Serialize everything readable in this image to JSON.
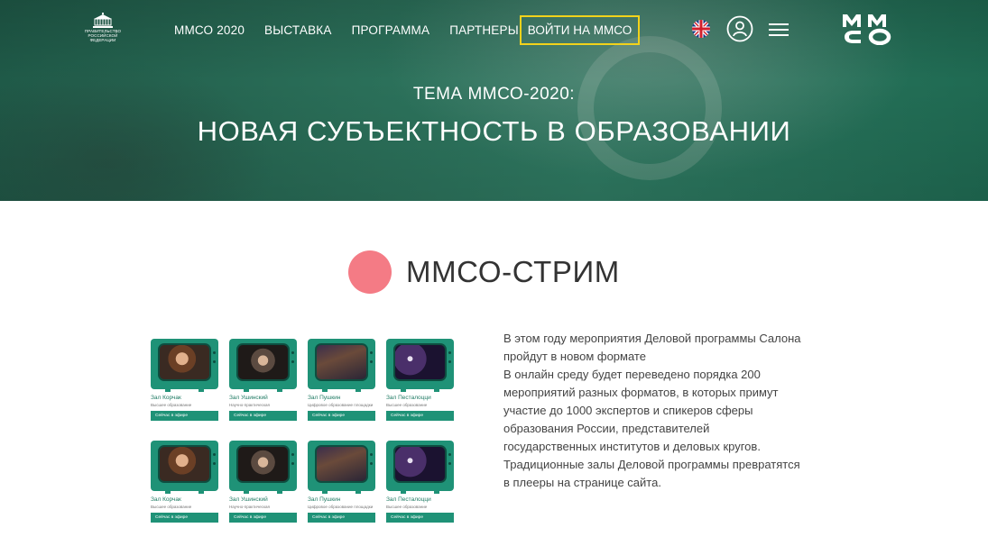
{
  "header": {
    "gov_logo_text": "ПРАВИТЕЛЬСТВО РОССИЙСКОЙ ФЕДЕРАЦИИ",
    "nav": [
      "ММСО 2020",
      "ВЫСТАВКА",
      "ПРОГРАММА",
      "ПАРТНЕРЫ"
    ],
    "login_label": "ВОЙТИ НА ММСО",
    "brand": "ММСО"
  },
  "hero": {
    "subtitle": "ТЕМА ММСО-2020:",
    "title": "НОВАЯ СУБЪЕКТНОСТЬ В ОБРАЗОВАНИИ"
  },
  "stream": {
    "title": "ММСО-СТРИМ",
    "cards": [
      {
        "name": "Зал Корчак",
        "desc": "Высшее образование",
        "button": "Сейчас в эфире"
      },
      {
        "name": "Зал Ушинский",
        "desc": "Научно-практическая",
        "button": "Сейчас в эфире"
      },
      {
        "name": "Зал Пушкин",
        "desc": "Цифровое образование площадки",
        "button": "Сейчас в эфире"
      },
      {
        "name": "Зал Песталоцци",
        "desc": "Высшее образование",
        "button": "Сейчас в эфире"
      },
      {
        "name": "Зал Корчак",
        "desc": "Высшее образование",
        "button": "Сейчас в эфире"
      },
      {
        "name": "Зал Ушинский",
        "desc": "Научно-практическая",
        "button": "Сейчас в эфире"
      },
      {
        "name": "Зал Пушкин",
        "desc": "Цифровое образование площадки",
        "button": "Сейчас в эфире"
      },
      {
        "name": "Зал Песталоцци",
        "desc": "Высшее образование",
        "button": "Сейчас в эфире"
      }
    ],
    "text_lines": [
      "В этом году мероприятия Деловой программы Салона",
      "пройдут в новом формате",
      "В онлайн среду будет переведено порядка 200",
      "мероприятий разных форматов, в которых примут",
      "участие до 1000 экспертов и спикеров сферы",
      "образования России, представителей",
      "государственных институтов и деловых кругов.",
      "Традиционные залы Деловой программы превратятся",
      "в плееры на странице сайта."
    ]
  },
  "colors": {
    "accent_green": "#1f9277",
    "login_border": "#f2d21b",
    "stream_dot": "#f47b85"
  }
}
